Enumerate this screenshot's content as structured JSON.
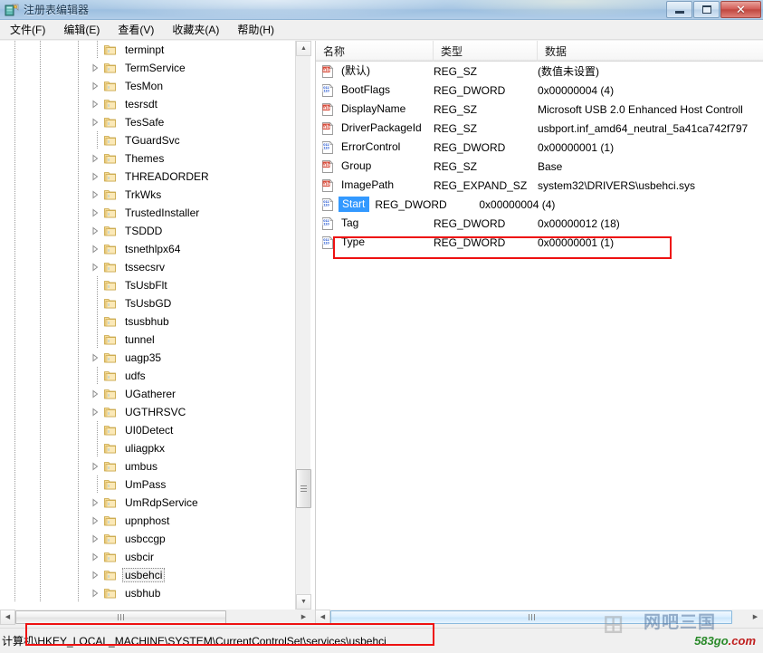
{
  "window": {
    "title": "注册表编辑器",
    "icon": "registry-editor-icon",
    "minimize_label": "",
    "maximize_label": "",
    "close_label": "✕"
  },
  "menubar": {
    "items": [
      {
        "label": "文件(F)",
        "name": "menu-file"
      },
      {
        "label": "编辑(E)",
        "name": "menu-edit"
      },
      {
        "label": "查看(V)",
        "name": "menu-view"
      },
      {
        "label": "收藏夹(A)",
        "name": "menu-favorites"
      },
      {
        "label": "帮助(H)",
        "name": "menu-help"
      }
    ]
  },
  "tree": {
    "selected_key": "usbehci",
    "items": [
      {
        "label": "terminpt",
        "expandable": false
      },
      {
        "label": "TermService",
        "expandable": true
      },
      {
        "label": "TesMon",
        "expandable": true
      },
      {
        "label": "tesrsdt",
        "expandable": true
      },
      {
        "label": "TesSafe",
        "expandable": true
      },
      {
        "label": "TGuardSvc",
        "expandable": false
      },
      {
        "label": "Themes",
        "expandable": true
      },
      {
        "label": "THREADORDER",
        "expandable": true
      },
      {
        "label": "TrkWks",
        "expandable": true
      },
      {
        "label": "TrustedInstaller",
        "expandable": true
      },
      {
        "label": "TSDDD",
        "expandable": true
      },
      {
        "label": "tsnethlpx64",
        "expandable": true
      },
      {
        "label": "tssecsrv",
        "expandable": true
      },
      {
        "label": "TsUsbFlt",
        "expandable": false
      },
      {
        "label": "TsUsbGD",
        "expandable": false
      },
      {
        "label": "tsusbhub",
        "expandable": false
      },
      {
        "label": "tunnel",
        "expandable": false
      },
      {
        "label": "uagp35",
        "expandable": true
      },
      {
        "label": "udfs",
        "expandable": false
      },
      {
        "label": "UGatherer",
        "expandable": true
      },
      {
        "label": "UGTHRSVC",
        "expandable": true
      },
      {
        "label": "UI0Detect",
        "expandable": false
      },
      {
        "label": "uliagpkx",
        "expandable": false
      },
      {
        "label": "umbus",
        "expandable": true
      },
      {
        "label": "UmPass",
        "expandable": false
      },
      {
        "label": "UmRdpService",
        "expandable": true
      },
      {
        "label": "upnphost",
        "expandable": true
      },
      {
        "label": "usbccgp",
        "expandable": true
      },
      {
        "label": "usbcir",
        "expandable": true
      },
      {
        "label": "usbehci",
        "expandable": true
      },
      {
        "label": "usbhub",
        "expandable": true
      }
    ]
  },
  "values": {
    "columns": [
      {
        "label": "名称",
        "name": "column-name"
      },
      {
        "label": "类型",
        "name": "column-type"
      },
      {
        "label": "数据",
        "name": "column-data"
      }
    ],
    "selected_row": "Start",
    "rows": [
      {
        "name": "(默认)",
        "type": "REG_SZ",
        "data": "(数值未设置)",
        "icon": "string-value-icon"
      },
      {
        "name": "BootFlags",
        "type": "REG_DWORD",
        "data": "0x00000004 (4)",
        "icon": "binary-value-icon"
      },
      {
        "name": "DisplayName",
        "type": "REG_SZ",
        "data": "Microsoft USB 2.0 Enhanced Host Controll",
        "icon": "string-value-icon"
      },
      {
        "name": "DriverPackageId",
        "type": "REG_SZ",
        "data": "usbport.inf_amd64_neutral_5a41ca742f797",
        "icon": "string-value-icon"
      },
      {
        "name": "ErrorControl",
        "type": "REG_DWORD",
        "data": "0x00000001 (1)",
        "icon": "binary-value-icon"
      },
      {
        "name": "Group",
        "type": "REG_SZ",
        "data": "Base",
        "icon": "string-value-icon"
      },
      {
        "name": "ImagePath",
        "type": "REG_EXPAND_SZ",
        "data": "system32\\DRIVERS\\usbehci.sys",
        "icon": "string-value-icon"
      },
      {
        "name": "Start",
        "type": "REG_DWORD",
        "data": "0x00000004 (4)",
        "icon": "binary-value-icon"
      },
      {
        "name": "Tag",
        "type": "REG_DWORD",
        "data": "0x00000012 (18)",
        "icon": "binary-value-icon"
      },
      {
        "name": "Type",
        "type": "REG_DWORD",
        "data": "0x00000001 (1)",
        "icon": "binary-value-icon"
      }
    ]
  },
  "statusbar": {
    "path": "计算机\\HKEY_LOCAL_MACHINE\\SYSTEM\\CurrentControlSet\\services\\usbehci"
  },
  "watermark": {
    "logo": "⊞",
    "cn_text": "网吧三国",
    "url_green": "583go",
    "url_red": ".com"
  },
  "colors": {
    "annotation_red": "#ee1111",
    "selection_blue": "#3399ff",
    "title_blue": "#a8c7e4"
  }
}
